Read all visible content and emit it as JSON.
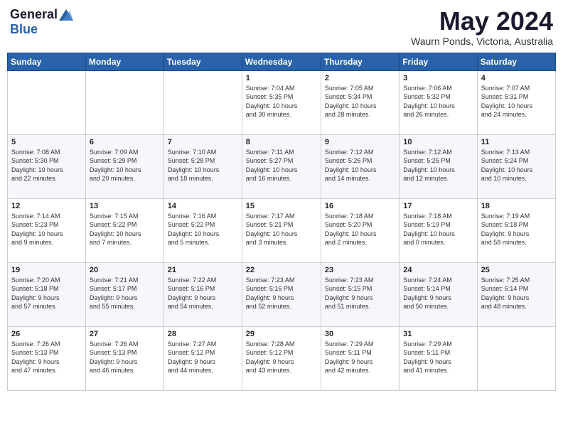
{
  "header": {
    "logo_general": "General",
    "logo_blue": "Blue",
    "month": "May 2024",
    "location": "Waurn Ponds, Victoria, Australia"
  },
  "weekdays": [
    "Sunday",
    "Monday",
    "Tuesday",
    "Wednesday",
    "Thursday",
    "Friday",
    "Saturday"
  ],
  "weeks": [
    [
      {
        "day": "",
        "content": ""
      },
      {
        "day": "",
        "content": ""
      },
      {
        "day": "",
        "content": ""
      },
      {
        "day": "1",
        "content": "Sunrise: 7:04 AM\nSunset: 5:35 PM\nDaylight: 10 hours\nand 30 minutes."
      },
      {
        "day": "2",
        "content": "Sunrise: 7:05 AM\nSunset: 5:34 PM\nDaylight: 10 hours\nand 28 minutes."
      },
      {
        "day": "3",
        "content": "Sunrise: 7:06 AM\nSunset: 5:32 PM\nDaylight: 10 hours\nand 26 minutes."
      },
      {
        "day": "4",
        "content": "Sunrise: 7:07 AM\nSunset: 5:31 PM\nDaylight: 10 hours\nand 24 minutes."
      }
    ],
    [
      {
        "day": "5",
        "content": "Sunrise: 7:08 AM\nSunset: 5:30 PM\nDaylight: 10 hours\nand 22 minutes."
      },
      {
        "day": "6",
        "content": "Sunrise: 7:09 AM\nSunset: 5:29 PM\nDaylight: 10 hours\nand 20 minutes."
      },
      {
        "day": "7",
        "content": "Sunrise: 7:10 AM\nSunset: 5:28 PM\nDaylight: 10 hours\nand 18 minutes."
      },
      {
        "day": "8",
        "content": "Sunrise: 7:11 AM\nSunset: 5:27 PM\nDaylight: 10 hours\nand 16 minutes."
      },
      {
        "day": "9",
        "content": "Sunrise: 7:12 AM\nSunset: 5:26 PM\nDaylight: 10 hours\nand 14 minutes."
      },
      {
        "day": "10",
        "content": "Sunrise: 7:12 AM\nSunset: 5:25 PM\nDaylight: 10 hours\nand 12 minutes."
      },
      {
        "day": "11",
        "content": "Sunrise: 7:13 AM\nSunset: 5:24 PM\nDaylight: 10 hours\nand 10 minutes."
      }
    ],
    [
      {
        "day": "12",
        "content": "Sunrise: 7:14 AM\nSunset: 5:23 PM\nDaylight: 10 hours\nand 9 minutes."
      },
      {
        "day": "13",
        "content": "Sunrise: 7:15 AM\nSunset: 5:22 PM\nDaylight: 10 hours\nand 7 minutes."
      },
      {
        "day": "14",
        "content": "Sunrise: 7:16 AM\nSunset: 5:22 PM\nDaylight: 10 hours\nand 5 minutes."
      },
      {
        "day": "15",
        "content": "Sunrise: 7:17 AM\nSunset: 5:21 PM\nDaylight: 10 hours\nand 3 minutes."
      },
      {
        "day": "16",
        "content": "Sunrise: 7:18 AM\nSunset: 5:20 PM\nDaylight: 10 hours\nand 2 minutes."
      },
      {
        "day": "17",
        "content": "Sunrise: 7:18 AM\nSunset: 5:19 PM\nDaylight: 10 hours\nand 0 minutes."
      },
      {
        "day": "18",
        "content": "Sunrise: 7:19 AM\nSunset: 5:18 PM\nDaylight: 9 hours\nand 58 minutes."
      }
    ],
    [
      {
        "day": "19",
        "content": "Sunrise: 7:20 AM\nSunset: 5:18 PM\nDaylight: 9 hours\nand 57 minutes."
      },
      {
        "day": "20",
        "content": "Sunrise: 7:21 AM\nSunset: 5:17 PM\nDaylight: 9 hours\nand 55 minutes."
      },
      {
        "day": "21",
        "content": "Sunrise: 7:22 AM\nSunset: 5:16 PM\nDaylight: 9 hours\nand 54 minutes."
      },
      {
        "day": "22",
        "content": "Sunrise: 7:23 AM\nSunset: 5:16 PM\nDaylight: 9 hours\nand 52 minutes."
      },
      {
        "day": "23",
        "content": "Sunrise: 7:23 AM\nSunset: 5:15 PM\nDaylight: 9 hours\nand 51 minutes."
      },
      {
        "day": "24",
        "content": "Sunrise: 7:24 AM\nSunset: 5:14 PM\nDaylight: 9 hours\nand 50 minutes."
      },
      {
        "day": "25",
        "content": "Sunrise: 7:25 AM\nSunset: 5:14 PM\nDaylight: 9 hours\nand 48 minutes."
      }
    ],
    [
      {
        "day": "26",
        "content": "Sunrise: 7:26 AM\nSunset: 5:13 PM\nDaylight: 9 hours\nand 47 minutes."
      },
      {
        "day": "27",
        "content": "Sunrise: 7:26 AM\nSunset: 5:13 PM\nDaylight: 9 hours\nand 46 minutes."
      },
      {
        "day": "28",
        "content": "Sunrise: 7:27 AM\nSunset: 5:12 PM\nDaylight: 9 hours\nand 44 minutes."
      },
      {
        "day": "29",
        "content": "Sunrise: 7:28 AM\nSunset: 5:12 PM\nDaylight: 9 hours\nand 43 minutes."
      },
      {
        "day": "30",
        "content": "Sunrise: 7:29 AM\nSunset: 5:11 PM\nDaylight: 9 hours\nand 42 minutes."
      },
      {
        "day": "31",
        "content": "Sunrise: 7:29 AM\nSunset: 5:11 PM\nDaylight: 9 hours\nand 41 minutes."
      },
      {
        "day": "",
        "content": ""
      }
    ]
  ]
}
